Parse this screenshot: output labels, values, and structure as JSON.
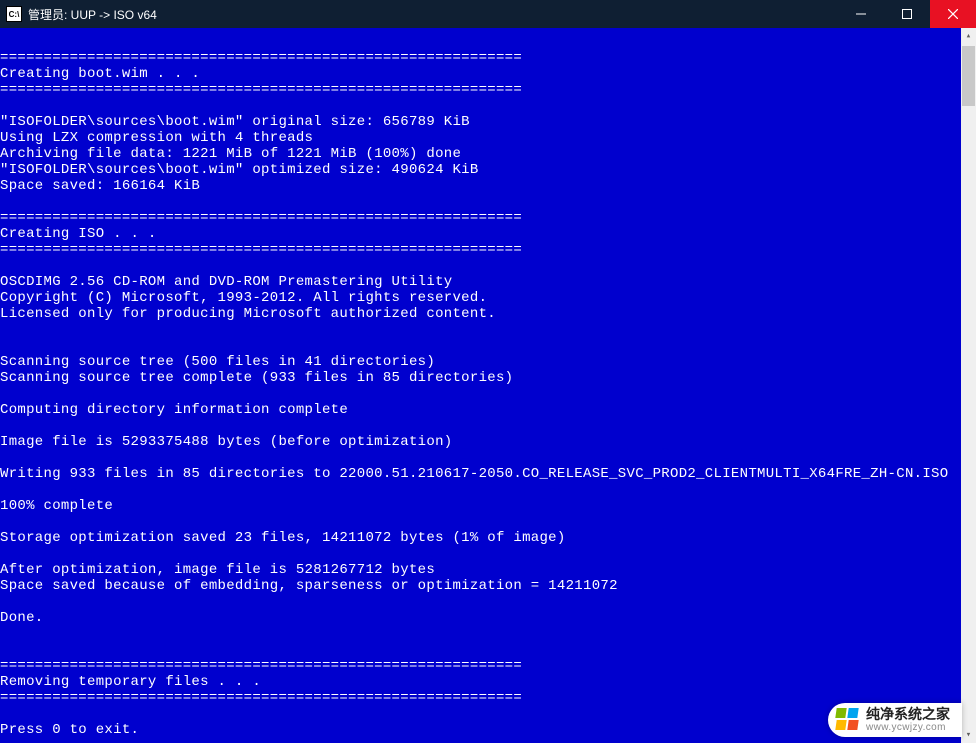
{
  "titlebar": {
    "icon_label": "C:\\",
    "title": "管理员:  UUP -> ISO v64"
  },
  "terminal": {
    "lines": [
      "",
      "============================================================",
      "Creating boot.wim . . .",
      "============================================================",
      "",
      "\"ISOFOLDER\\sources\\boot.wim\" original size: 656789 KiB",
      "Using LZX compression with 4 threads",
      "Archiving file data: 1221 MiB of 1221 MiB (100%) done",
      "\"ISOFOLDER\\sources\\boot.wim\" optimized size: 490624 KiB",
      "Space saved: 166164 KiB",
      "",
      "============================================================",
      "Creating ISO . . .",
      "============================================================",
      "",
      "OSCDIMG 2.56 CD-ROM and DVD-ROM Premastering Utility",
      "Copyright (C) Microsoft, 1993-2012. All rights reserved.",
      "Licensed only for producing Microsoft authorized content.",
      "",
      "",
      "Scanning source tree (500 files in 41 directories)",
      "Scanning source tree complete (933 files in 85 directories)",
      "",
      "Computing directory information complete",
      "",
      "Image file is 5293375488 bytes (before optimization)",
      "",
      "Writing 933 files in 85 directories to 22000.51.210617-2050.CO_RELEASE_SVC_PROD2_CLIENTMULTI_X64FRE_ZH-CN.ISO",
      "",
      "100% complete",
      "",
      "Storage optimization saved 23 files, 14211072 bytes (1% of image)",
      "",
      "After optimization, image file is 5281267712 bytes",
      "Space saved because of embedding, sparseness or optimization = 14211072",
      "",
      "Done.",
      "",
      "",
      "============================================================",
      "Removing temporary files . . .",
      "============================================================",
      "",
      "Press 0 to exit."
    ]
  },
  "watermark": {
    "main": "纯净系统之家",
    "sub": "www.ycwjzy.com"
  }
}
